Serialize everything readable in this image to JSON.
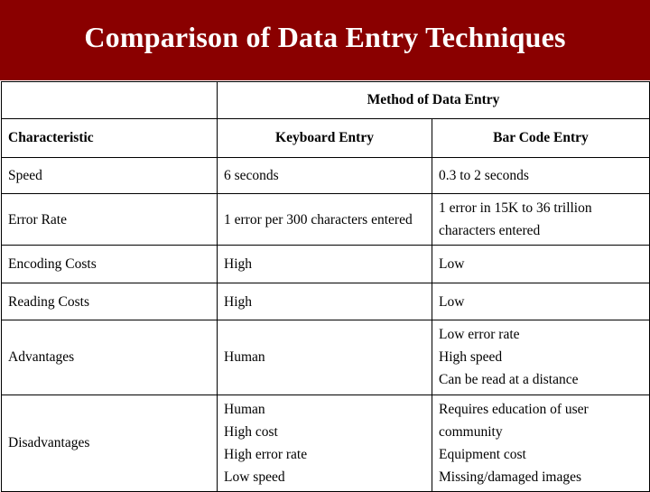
{
  "slide": {
    "title": "Comparison of Data Entry Techniques",
    "banner_color": "#8a0000",
    "title_color": "#ffffff"
  },
  "table": {
    "header_top": {
      "blank": "",
      "group_label": "Method of Data Entry"
    },
    "header_columns": {
      "characteristic": "Characteristic",
      "keyboard": "Keyboard Entry",
      "barcode": "Bar Code Entry"
    },
    "rows": [
      {
        "characteristic": "Speed",
        "keyboard": "6 seconds",
        "barcode": "0.3 to 2 seconds"
      },
      {
        "characteristic": "Error Rate",
        "keyboard": "1 error per 300 characters entered",
        "barcode": "1 error in 15K to 36 trillion characters entered"
      },
      {
        "characteristic": "Encoding Costs",
        "keyboard": "High",
        "barcode": "Low"
      },
      {
        "characteristic": "Reading Costs",
        "keyboard": "High",
        "barcode": "Low"
      },
      {
        "characteristic": "Advantages",
        "keyboard": "Human",
        "barcode_lines": [
          "Low error rate",
          "High speed",
          "Can be read at a distance"
        ]
      },
      {
        "characteristic": "Disadvantages",
        "keyboard_lines": [
          "Human",
          "High cost",
          "High error rate",
          "Low speed"
        ],
        "barcode_lines": [
          "Requires education of user community",
          "Equipment cost",
          "Missing/damaged images"
        ]
      }
    ]
  }
}
